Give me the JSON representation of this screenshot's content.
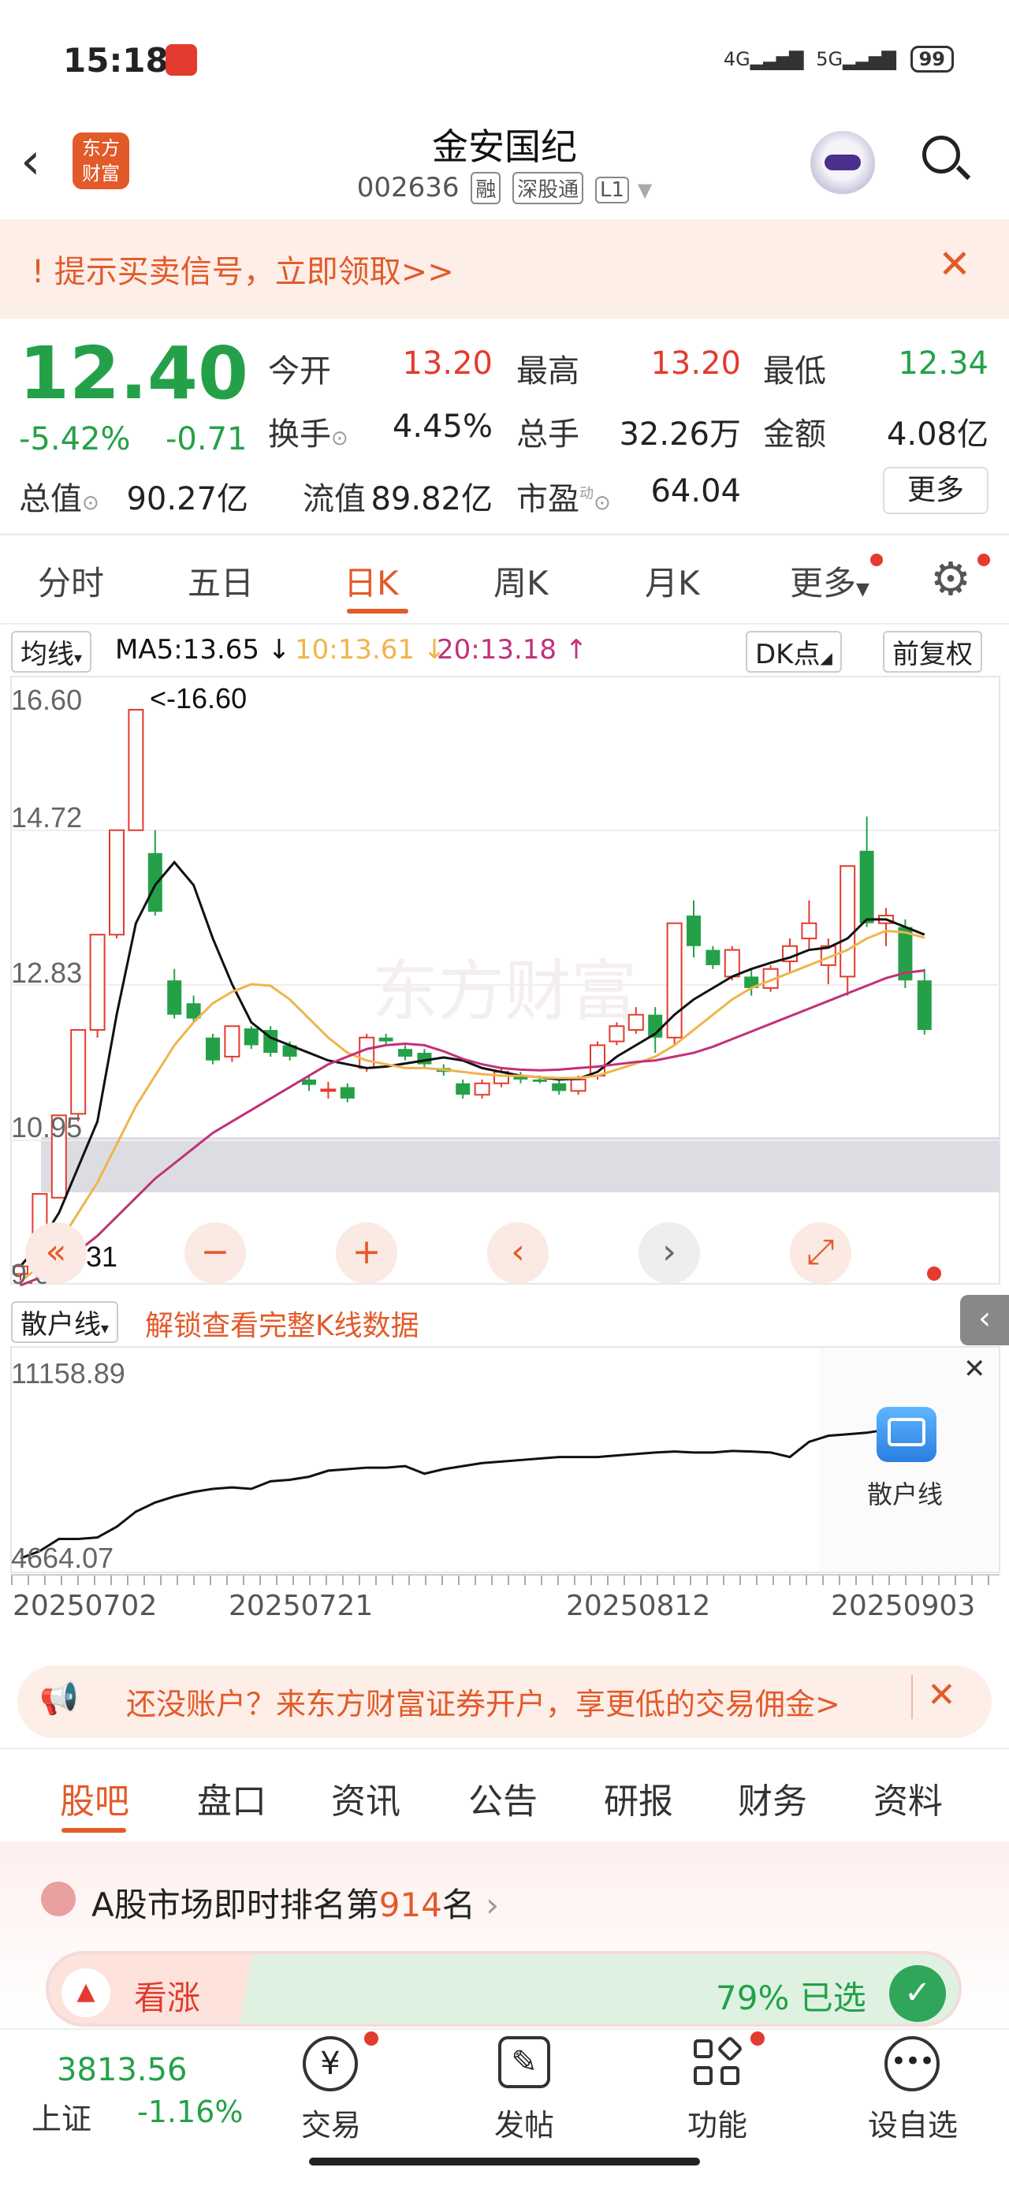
{
  "status": {
    "time": "15:18",
    "net1": "4G",
    "net2": "5G",
    "battery": "99"
  },
  "header": {
    "title": "金安国纪",
    "code": "002636",
    "tags": [
      "融",
      "深股通",
      "L1"
    ]
  },
  "banner": {
    "text": "提示买卖信号，立即领取>>"
  },
  "quote": {
    "price": "12.40",
    "change_pct": "-5.42%",
    "change": "-0.71",
    "open_label": "今开",
    "open": "13.20",
    "high_label": "最高",
    "high": "13.20",
    "low_label": "最低",
    "low": "12.34",
    "turnover_label": "换手",
    "turnover": "4.45%",
    "volume_label": "总手",
    "volume": "32.26万",
    "amount_label": "金额",
    "amount": "4.08亿",
    "mcap_label": "总值",
    "mcap": "90.27亿",
    "float_label": "流值",
    "float": "89.82亿",
    "pe_label": "市盈",
    "pe_sup": "动",
    "pe": "64.04",
    "more": "更多"
  },
  "tabs": [
    "分时",
    "五日",
    "日K",
    "周K",
    "月K",
    "更多"
  ],
  "chart": {
    "ma_select": "均线",
    "ma5": "MA5:13.65 ↓",
    "ma10": "10:13.61 ↓",
    "ma20": "20:13.18 ↑",
    "dk": "DK点",
    "fq": "前复权",
    "yticks": [
      "16.60",
      "14.72",
      "12.83",
      "10.95",
      "9.07"
    ],
    "high_marker": "<-16.60",
    "low_marker": "<-9.31",
    "watermark": "东方财富",
    "sub_select": "散户线",
    "unlock": "解锁查看完整K线数据",
    "sub_top": "11158.89",
    "sub_bottom": "4664.07",
    "sub_badge": "散户线",
    "xticks": [
      "20250702",
      "20250721",
      "20250812",
      "20250903"
    ],
    "colors": {
      "up": "#e33b2f",
      "down": "#24a148",
      "ma5": "#111111",
      "ma10": "#f0b44c",
      "ma20": "#c2307a"
    }
  },
  "chart_data": {
    "type": "candlestick",
    "candles": [
      [
        9.2,
        9.3,
        9.05,
        9.32
      ],
      [
        9.3,
        10.25,
        9.3,
        10.25
      ],
      [
        10.2,
        11.28,
        10.2,
        11.28
      ],
      [
        11.3,
        12.4,
        11.2,
        12.4
      ],
      [
        12.4,
        13.65,
        12.3,
        13.65
      ],
      [
        13.65,
        15.02,
        13.6,
        15.02
      ],
      [
        15.02,
        16.6,
        15.02,
        16.6
      ],
      [
        14.72,
        13.95,
        13.9,
        15.02
      ],
      [
        13.05,
        12.6,
        12.55,
        13.2
      ],
      [
        12.75,
        12.55,
        12.5,
        12.85
      ],
      [
        12.3,
        12.0,
        11.95,
        12.35
      ],
      [
        12.05,
        12.45,
        11.98,
        12.45
      ],
      [
        12.42,
        12.2,
        12.15,
        12.45
      ],
      [
        12.4,
        12.1,
        12.05,
        12.45
      ],
      [
        12.2,
        12.05,
        12.0,
        12.25
      ],
      [
        11.75,
        11.68,
        11.6,
        11.8
      ],
      [
        11.6,
        11.62,
        11.5,
        11.72
      ],
      [
        11.65,
        11.5,
        11.45,
        11.7
      ],
      [
        11.9,
        12.3,
        11.85,
        12.35
      ],
      [
        12.3,
        12.25,
        12.2,
        12.35
      ],
      [
        12.15,
        12.05,
        12.0,
        12.2
      ],
      [
        12.1,
        11.95,
        11.9,
        12.15
      ],
      [
        11.9,
        11.85,
        11.8,
        11.95
      ],
      [
        11.7,
        11.55,
        11.5,
        11.75
      ],
      [
        11.55,
        11.7,
        11.5,
        11.75
      ],
      [
        11.7,
        11.85,
        11.65,
        11.9
      ],
      [
        11.8,
        11.75,
        11.7,
        11.85
      ],
      [
        11.75,
        11.72,
        11.7,
        11.8
      ],
      [
        11.7,
        11.6,
        11.55,
        11.75
      ],
      [
        11.6,
        11.75,
        11.55,
        11.8
      ],
      [
        11.8,
        12.2,
        11.75,
        12.25
      ],
      [
        12.25,
        12.45,
        12.2,
        12.5
      ],
      [
        12.4,
        12.6,
        12.35,
        12.7
      ],
      [
        12.6,
        12.3,
        12.1,
        12.7
      ],
      [
        12.3,
        13.8,
        12.2,
        13.8
      ],
      [
        13.9,
        13.5,
        13.35,
        14.1
      ],
      [
        13.45,
        13.25,
        13.2,
        13.5
      ],
      [
        13.1,
        13.45,
        13.05,
        13.5
      ],
      [
        13.1,
        12.95,
        12.85,
        13.2
      ],
      [
        12.95,
        13.2,
        12.9,
        13.25
      ],
      [
        13.3,
        13.5,
        13.15,
        13.6
      ],
      [
        13.6,
        13.8,
        13.45,
        14.1
      ],
      [
        13.25,
        13.5,
        13.0,
        13.6
      ],
      [
        13.1,
        14.55,
        12.85,
        14.55
      ],
      [
        14.75,
        13.8,
        13.75,
        15.2
      ],
      [
        13.8,
        13.9,
        13.5,
        14.0
      ],
      [
        13.75,
        13.05,
        12.95,
        13.85
      ],
      [
        13.05,
        12.4,
        12.34,
        13.2
      ]
    ],
    "ma5": [
      9.3,
      9.6,
      10.0,
      10.6,
      11.2,
      12.6,
      13.8,
      14.3,
      14.6,
      14.3,
      13.6,
      13.0,
      12.5,
      12.3,
      12.2,
      12.1,
      12.0,
      11.95,
      11.9,
      11.92,
      11.96,
      12.0,
      12.04,
      12.0,
      11.9,
      11.85,
      11.8,
      11.78,
      11.75,
      11.76,
      11.85,
      12.05,
      12.2,
      12.35,
      12.6,
      12.8,
      12.95,
      13.1,
      13.2,
      13.28,
      13.35,
      13.45,
      13.48,
      13.6,
      13.85,
      13.85,
      13.75,
      13.65
    ],
    "ma10": [
      9.1,
      9.3,
      9.6,
      10.0,
      10.4,
      10.9,
      11.4,
      11.8,
      12.2,
      12.5,
      12.75,
      12.9,
      13.0,
      12.98,
      12.8,
      12.55,
      12.3,
      12.1,
      12.0,
      11.95,
      11.9,
      11.9,
      11.88,
      11.85,
      11.82,
      11.8,
      11.8,
      11.78,
      11.77,
      11.77,
      11.8,
      11.88,
      11.96,
      12.05,
      12.2,
      12.4,
      12.6,
      12.8,
      12.95,
      13.05,
      13.15,
      13.25,
      13.35,
      13.45,
      13.6,
      13.7,
      13.68,
      13.61
    ],
    "ma20": [
      9.05,
      9.15,
      9.3,
      9.5,
      9.7,
      9.95,
      10.2,
      10.45,
      10.65,
      10.85,
      11.05,
      11.2,
      11.35,
      11.5,
      11.65,
      11.8,
      11.95,
      12.05,
      12.15,
      12.2,
      12.22,
      12.2,
      12.12,
      12.02,
      11.95,
      11.9,
      11.88,
      11.87,
      11.88,
      11.9,
      11.92,
      11.95,
      11.98,
      12.0,
      12.05,
      12.1,
      12.18,
      12.28,
      12.38,
      12.48,
      12.58,
      12.68,
      12.78,
      12.88,
      12.98,
      13.08,
      13.15,
      13.18
    ],
    "retail": [
      4664,
      4900,
      5300,
      5300,
      5350,
      5700,
      6200,
      6500,
      6700,
      6850,
      6950,
      7000,
      6950,
      7200,
      7250,
      7350,
      7550,
      7600,
      7650,
      7650,
      7700,
      7450,
      7600,
      7700,
      7800,
      7850,
      7900,
      7950,
      8000,
      8000,
      8000,
      8050,
      8100,
      8150,
      8180,
      8150,
      8150,
      8200,
      8180,
      8150,
      8000,
      8500,
      8700,
      8750,
      8800,
      8900,
      8850,
      8800
    ],
    "ylim": [
      9.07,
      16.6
    ],
    "sub_ylim": [
      4664.07,
      11158.89
    ]
  },
  "ad": {
    "text": "还没账户？来东方财富证券开户，享更低的交易佣金>"
  },
  "bottom_tabs": [
    "股吧",
    "盘口",
    "资讯",
    "公告",
    "研报",
    "财务",
    "资料"
  ],
  "ranking": {
    "prefix": "A股市场即时排名第",
    "rank": "914",
    "suffix": "名"
  },
  "vote": {
    "label": "看涨",
    "pct": "79% 已选"
  },
  "nav": {
    "index_value": "3813.56",
    "index_name": "上证",
    "index_change": "-1.16%",
    "items": [
      "交易",
      "发帖",
      "功能",
      "设自选"
    ]
  }
}
